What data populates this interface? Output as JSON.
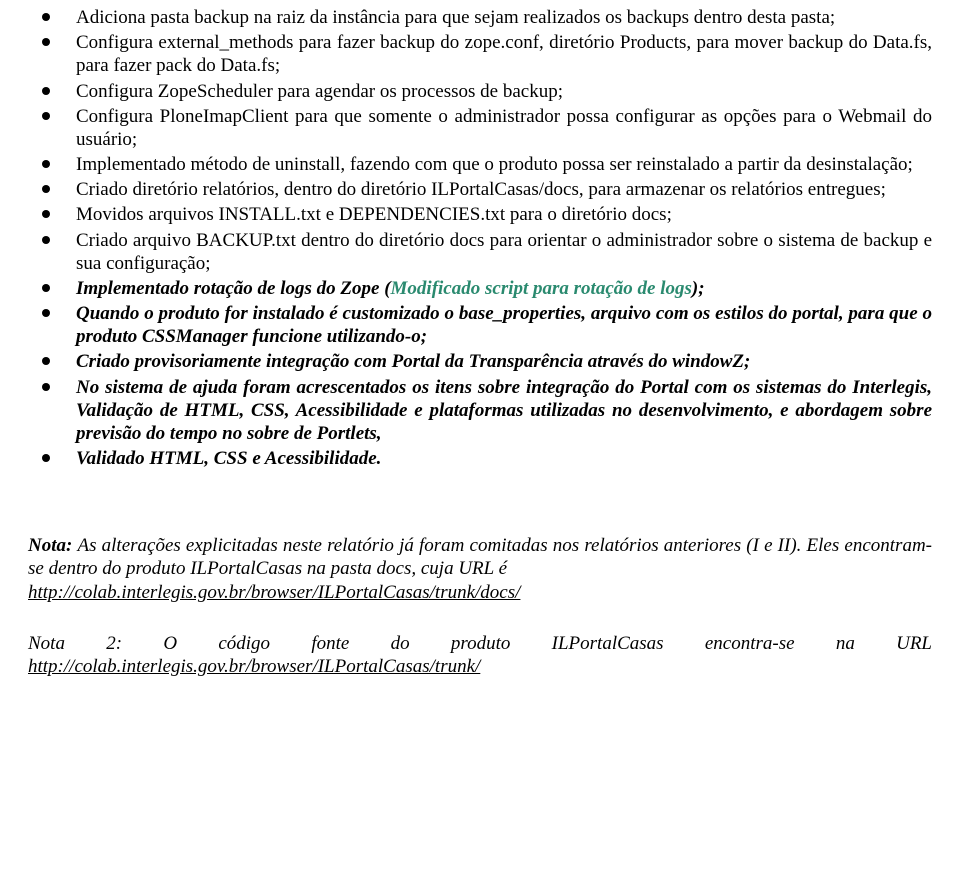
{
  "bullets": {
    "b1": "Adiciona pasta backup na raiz da instância para que sejam realizados os backups dentro desta pasta;",
    "b2": "Configura external_methods para fazer backup do zope.conf, diretório Products, para mover backup do Data.fs, para fazer pack do Data.fs;",
    "b3": "Configura ZopeScheduler para agendar os processos de backup;",
    "b4": "Configura PloneImapClient para que somente o administrador possa configurar as opções para o Webmail do usuário;",
    "b5": "Implementado método de uninstall, fazendo com que o produto possa ser reinstalado a partir da desinstalação;",
    "b6": "Criado diretório relatórios, dentro do diretório ILPortalCasas/docs, para armazenar os relatórios entregues;",
    "b7": "Movidos arquivos INSTALL.txt e DEPENDENCIES.txt para o diretório docs;",
    "b8": "Criado arquivo BACKUP.txt dentro do diretório docs para orientar o administrador sobre o sistema de backup e sua configuração;",
    "b9a": "Implementado rotação de logs do Zope (",
    "b9b": "Modificado script para rotação de logs",
    "b9c": ");",
    "b10": "Quando o produto for instalado é customizado o base_properties, arquivo com os estilos do portal, para que o produto CSSManager funcione utilizando-o;",
    "b11": "Criado provisoriamente integração com Portal da Transparência através do windowZ;",
    "b12": "No sistema de ajuda foram acrescentados os itens sobre integração do Portal com os sistemas do Interlegis, Validação de HTML, CSS, Acessibilidade e plataformas utilizadas no desenvolvimento, e abordagem sobre previsão do tempo no sobre de Portlets,",
    "b13": "Validado HTML, CSS e Acessibilidade."
  },
  "note1": {
    "intro": "Nota: ",
    "body": "As alterações explicitadas neste relatório já foram comitadas nos relatórios anteriores (I e II). Eles encontram-se dentro do produto ILPortalCasas na pasta docs, cuja URL é ",
    "link": "http://colab.interlegis.gov.br/browser/ILPortalCasas/trunk/docs/"
  },
  "note2": {
    "line": "Nota 2: O código fonte do produto ILPortalCasas encontra-se na URL",
    "link": "http://colab.interlegis.gov.br/browser/ILPortalCasas/trunk/"
  }
}
